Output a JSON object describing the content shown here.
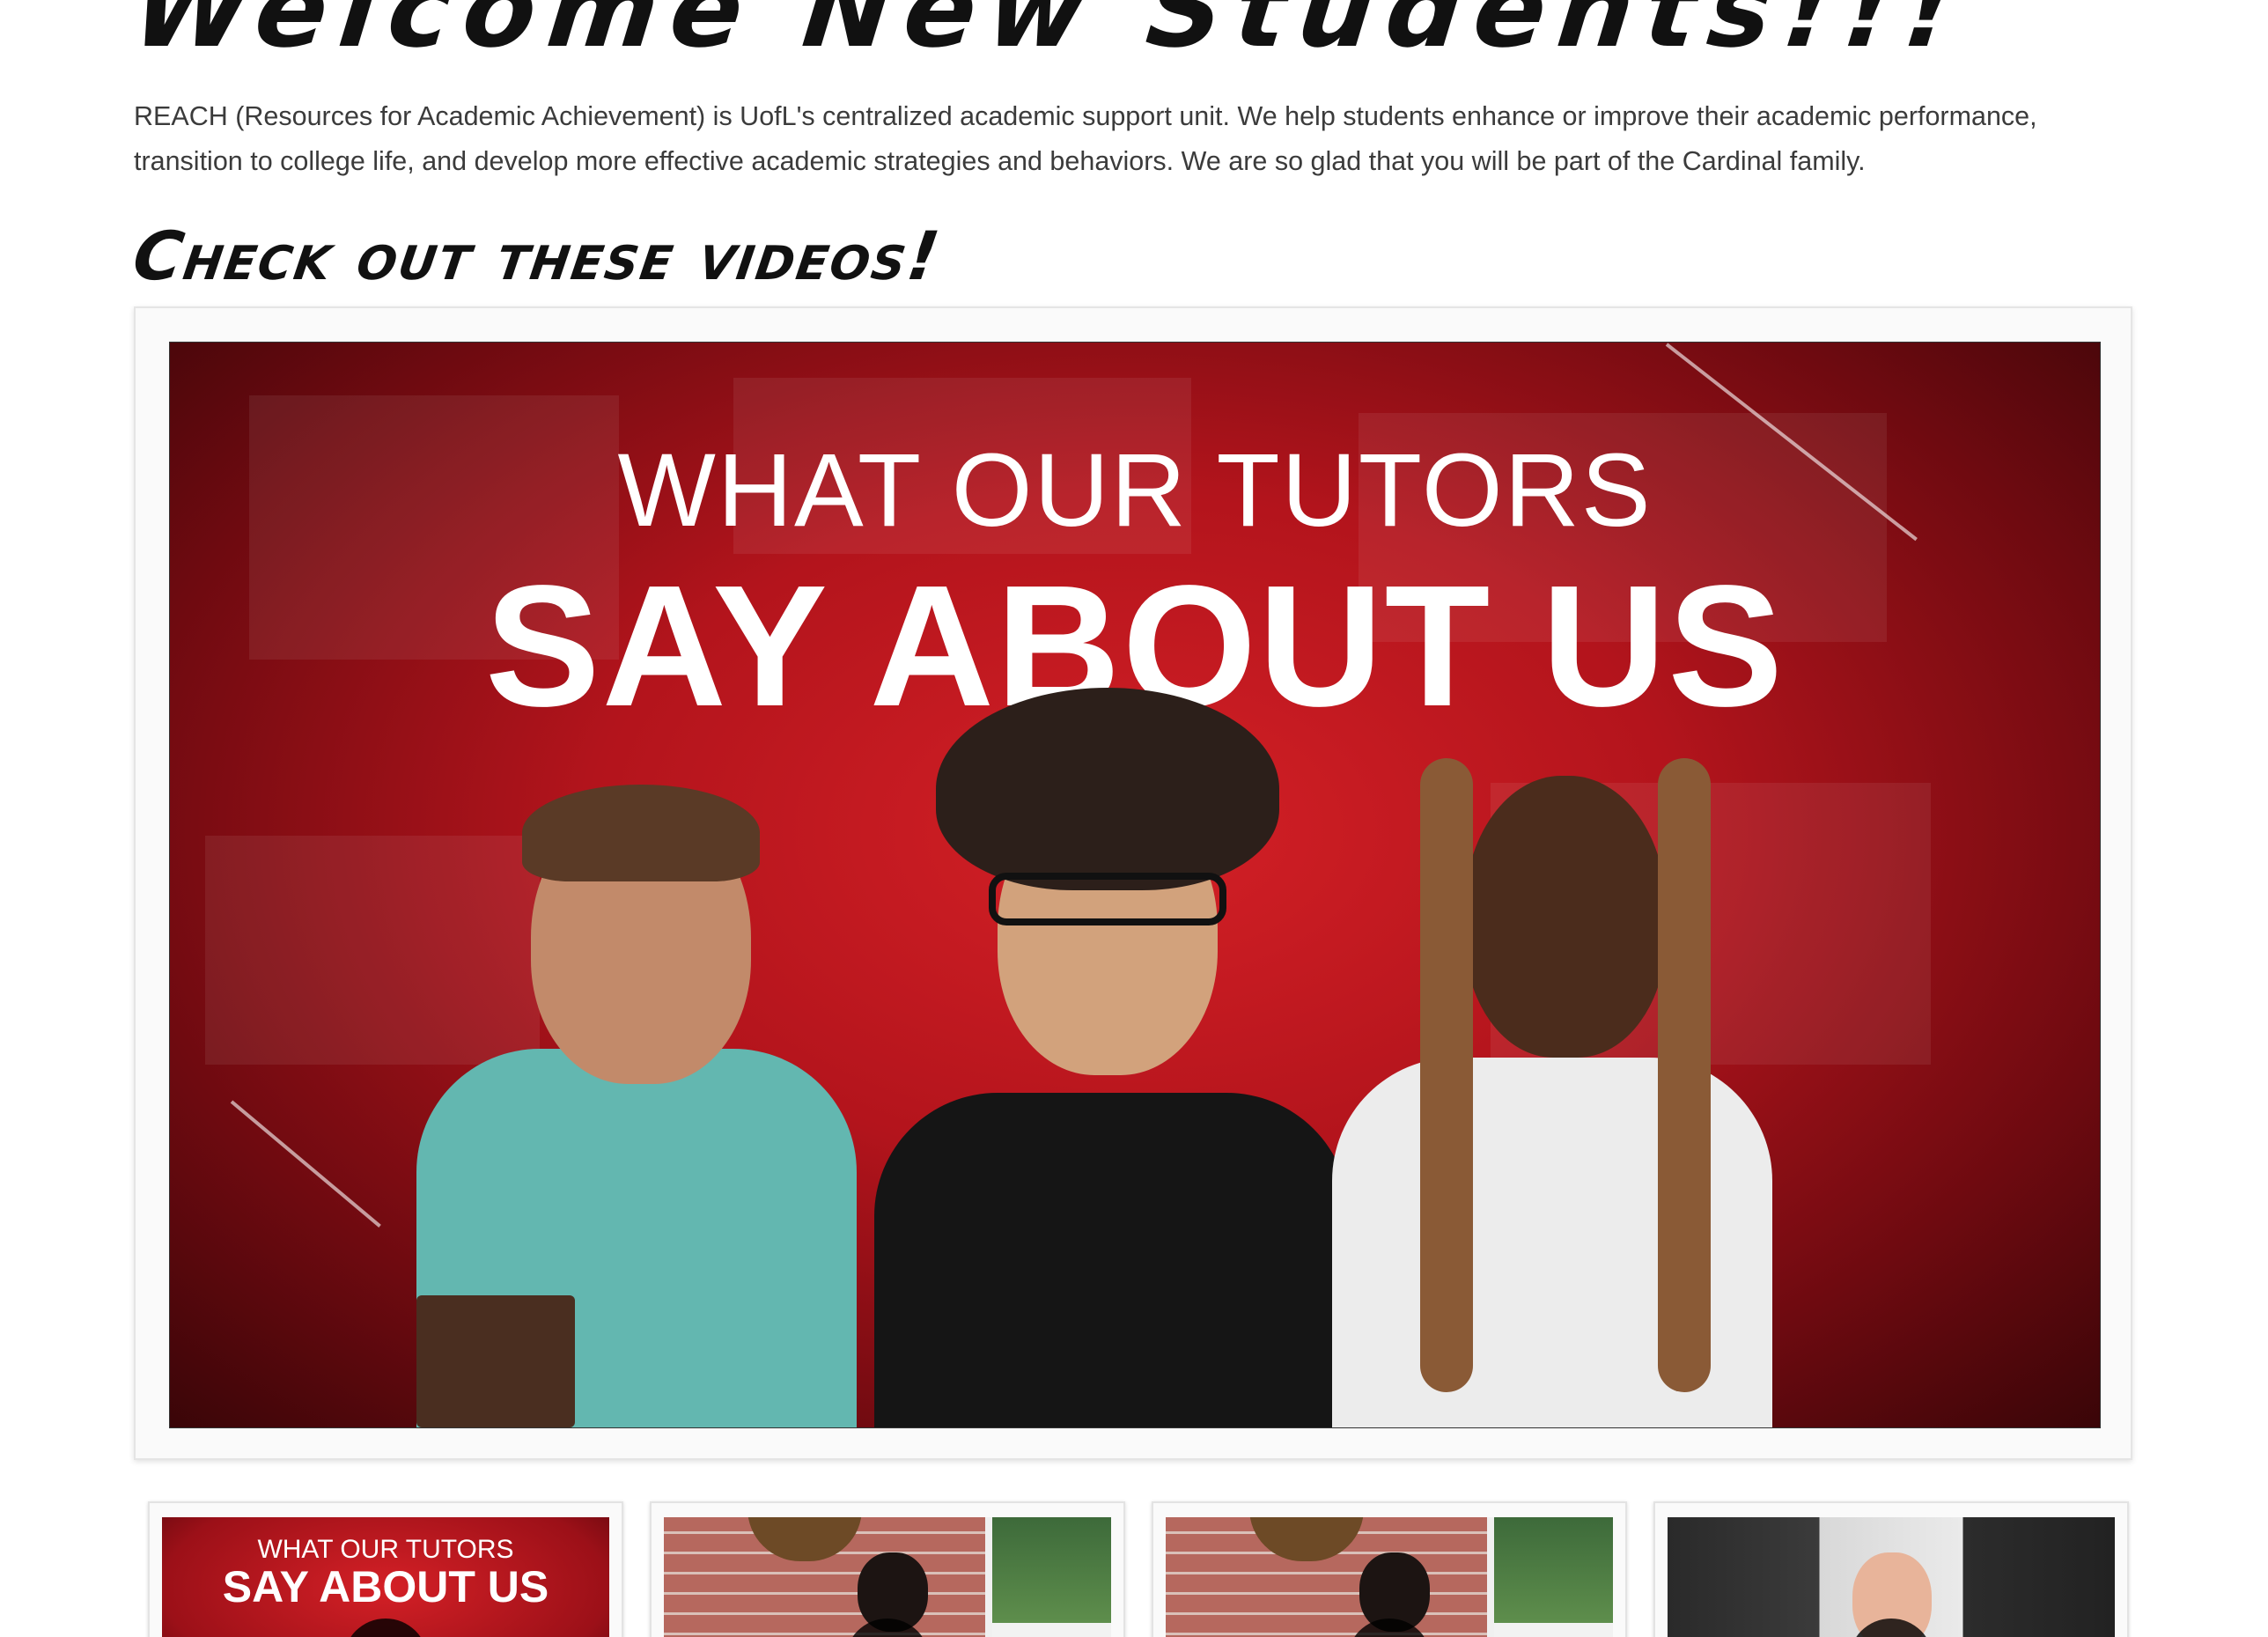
{
  "heading": "Welcome New Students!!!",
  "intro_text": "REACH (Resources for Academic Achievement) is UofL's centralized academic support unit. We help students enhance or improve their academic performance, transition to college life, and develop more effective academic strategies and behaviors. We are so glad that you will be part of the Cardinal family.",
  "videos_heading": "Check out these videos!",
  "featured_video": {
    "title_line1": "WHAT OUR TUTORS",
    "title_line2": "SAY ABOUT US"
  },
  "thumbnails": [
    {
      "title_line1": "WHAT OUR TUTORS",
      "title_line2": "SAY ABOUT US",
      "style": "red"
    },
    {
      "style": "brick"
    },
    {
      "style": "brick"
    },
    {
      "style": "dark"
    }
  ],
  "colors": {
    "brand_red": "#d42026",
    "text": "#3b3b3b",
    "heading": "#111111"
  }
}
